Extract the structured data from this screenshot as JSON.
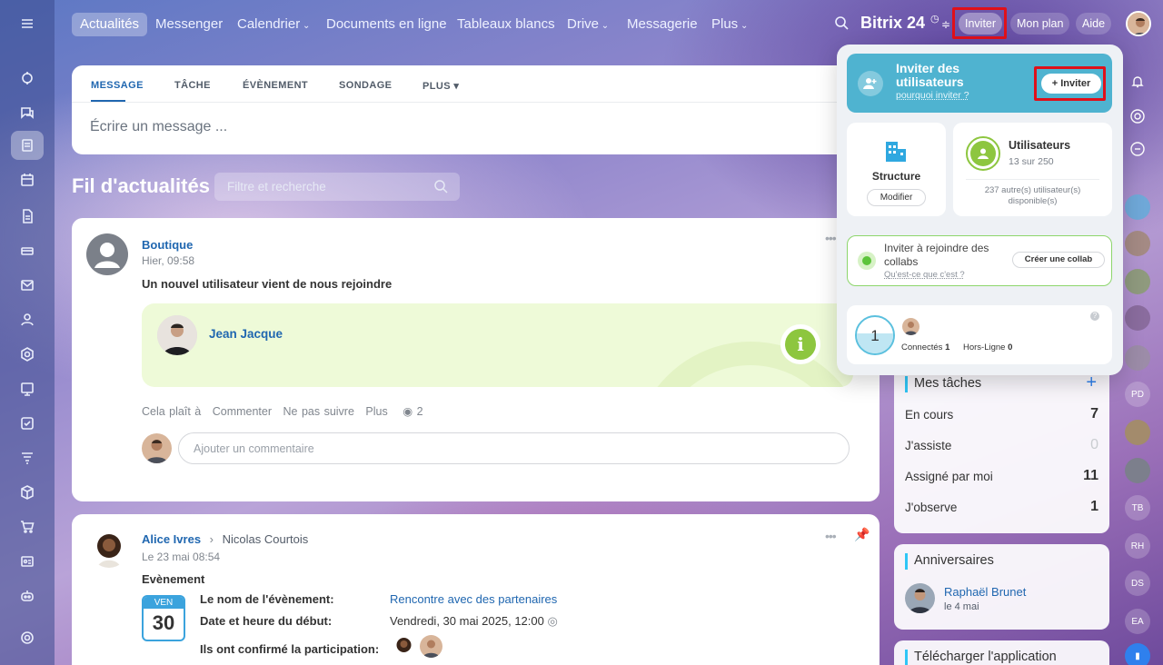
{
  "nav": {
    "tabs": [
      "Actualités",
      "Messenger",
      "Calendrier",
      "Documents en ligne",
      "Tableaux blancs",
      "Drive",
      "Messagerie",
      "Plus"
    ],
    "logo": "Bitrix 24",
    "invite": "Inviter",
    "plan": "Mon plan",
    "help": "Aide"
  },
  "composer": {
    "tabs": [
      "MESSAGE",
      "TÂCHE",
      "ÉVÈNEMENT",
      "SONDAGE",
      "PLUS"
    ],
    "placeholder": "Écrire un message ..."
  },
  "feed": {
    "title": "Fil d'actualités",
    "search_placeholder": "Filtre et recherche"
  },
  "post1": {
    "author": "Boutique",
    "time": "Hier, 09:58",
    "text": "Un nouvel utilisateur vient de nous rejoindre",
    "user": "Jean Jacque",
    "actions": [
      "Cela plaît à",
      "Commenter",
      "Ne pas suivre",
      "Plus"
    ],
    "views": "2",
    "comment_placeholder": "Ajouter un commentaire"
  },
  "post2": {
    "author": "Alice Ivres",
    "recipient": "Nicolas Courtois",
    "time": "Le 23 mai 08:54",
    "type": "Evènement",
    "day_name": "VEN",
    "day_num": "30",
    "event_label": "Le nom de l'évènement:",
    "event_value": "Rencontre avec des partenaires",
    "start_label": "Date et heure du début:",
    "start_value": "Vendredi, 30 mai 2025, 12:00",
    "confirmed_label": "Ils ont confirmé la participation:"
  },
  "tasks": {
    "title": "Mes tâches",
    "rows": [
      {
        "label": "En cours",
        "value": "7"
      },
      {
        "label": "J'assiste",
        "value": "0"
      },
      {
        "label": "Assigné par moi",
        "value": "11"
      },
      {
        "label": "J'observe",
        "value": "1"
      }
    ]
  },
  "birthdays": {
    "title": "Anniversaires",
    "name": "Raphaël Brunet",
    "date": "le 4 mai"
  },
  "download": {
    "title": "Télécharger l'application"
  },
  "popup": {
    "invite_title": "Inviter des utilisateurs",
    "invite_why": "pourquoi inviter ?",
    "invite_button": "+ Inviter",
    "structure": "Structure",
    "modify": "Modifier",
    "users_title": "Utilisateurs",
    "users_count": "13 sur 250",
    "users_available": "237 autre(s) utilisateur(s) disponible(s)",
    "collab_title": "Inviter à rejoindre des collabs",
    "collab_what": "Qu'est-ce que c'est ?",
    "collab_button": "Créer une collab",
    "online_count": "1",
    "connected_label": "Connectés",
    "connected_value": "1",
    "offline_label": "Hors-Ligne",
    "offline_value": "0"
  },
  "right_avatars": [
    "PD",
    "TB",
    "RH",
    "DS",
    "EA"
  ],
  "colors": {
    "accent": "#2067b0",
    "popup_teal": "#4fb3d0",
    "green": "#8dc63f",
    "highlight": "#e0101a"
  }
}
